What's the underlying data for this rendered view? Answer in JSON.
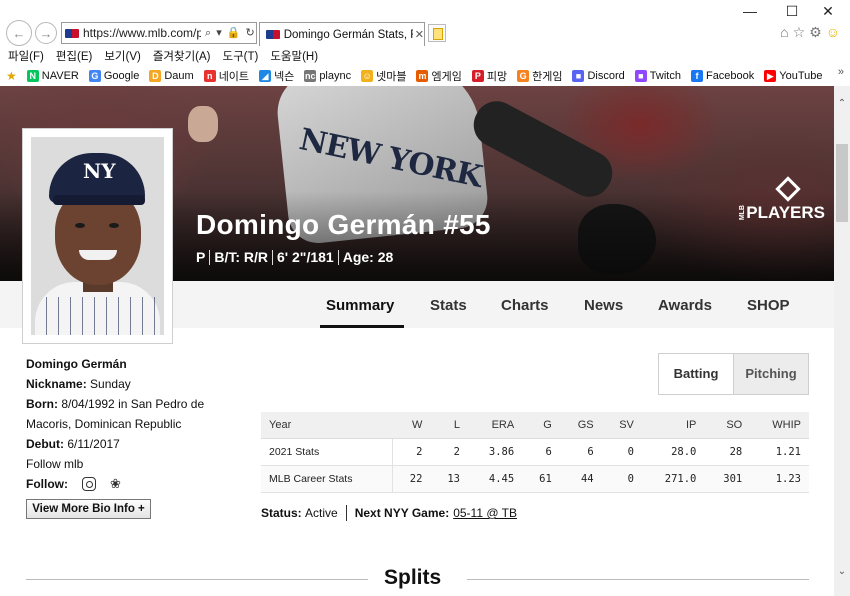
{
  "browser": {
    "url": "https://www.mlb.com/plá",
    "addr_icons": "⌕ ▾ 🔒 ↻",
    "tab_title": "Domingo Germán Stats, Fa...",
    "menu": [
      "파일(F)",
      "편집(E)",
      "보기(V)",
      "즐겨찾기(A)",
      "도구(T)",
      "도움말(H)"
    ],
    "favorites": [
      {
        "label": "NAVER",
        "icon": "naver-icon",
        "color": "#03c75a",
        "glyph": "N"
      },
      {
        "label": "Google",
        "icon": "google-icon",
        "color": "#4285f4",
        "glyph": "G"
      },
      {
        "label": "Daum",
        "icon": "daum-icon",
        "color": "#f5a623",
        "glyph": "D"
      },
      {
        "label": "네이트",
        "icon": "nate-icon",
        "color": "#e8322f",
        "glyph": "n"
      },
      {
        "label": "넥슨",
        "icon": "nexon-icon",
        "color": "#1e88e5",
        "glyph": "◢"
      },
      {
        "label": "plaync",
        "icon": "plaync-icon",
        "color": "#777777",
        "glyph": "nc"
      },
      {
        "label": "넷마블",
        "icon": "netmarble-icon",
        "color": "#f3b21c",
        "glyph": "☺"
      },
      {
        "label": "엠게임",
        "icon": "mgame-icon",
        "color": "#e65c00",
        "glyph": "m"
      },
      {
        "label": "피망",
        "icon": "pmang-icon",
        "color": "#d61e28",
        "glyph": "P"
      },
      {
        "label": "한게임",
        "icon": "hangame-icon",
        "color": "#f58220",
        "glyph": "G"
      },
      {
        "label": "Discord",
        "icon": "discord-icon",
        "color": "#5865f2",
        "glyph": "■"
      },
      {
        "label": "Twitch",
        "icon": "twitch-icon",
        "color": "#9146ff",
        "glyph": "■"
      },
      {
        "label": "Facebook",
        "icon": "facebook-icon",
        "color": "#1877f2",
        "glyph": "f"
      },
      {
        "label": "YouTube",
        "icon": "youtube-icon",
        "color": "#ff0000",
        "glyph": "▶"
      }
    ]
  },
  "hero": {
    "name": "Domingo Germán #55",
    "position": "P",
    "bats_throws": "B/T: R/R",
    "height_weight": "6' 2\"/181",
    "age": "Age: 28",
    "logo_text": "PLAYERS",
    "logo_small": "MLB",
    "jersey_text": "NEW YORK",
    "cap_logo": "NY"
  },
  "subnav": [
    "Summary",
    "Stats",
    "Charts",
    "News",
    "Awards",
    "SHOP"
  ],
  "bio": {
    "full_name": "Domingo Germán",
    "nickname_label": "Nickname:",
    "nickname": "Sunday",
    "born_label": "Born:",
    "born": "8/04/1992 in San Pedro de Macoris, Dominican Republic",
    "debut_label": "Debut:",
    "debut": "6/11/2017",
    "follow_mlb": "Follow mlb",
    "follow_label": "Follow:",
    "more_button": "View More Bio Info +"
  },
  "toggle": {
    "batting": "Batting",
    "pitching": "Pitching"
  },
  "stats_table": {
    "headers": [
      "Year",
      "W",
      "L",
      "ERA",
      "G",
      "GS",
      "SV",
      "IP",
      "SO",
      "WHIP"
    ],
    "rows": [
      [
        "2021 Stats",
        "2",
        "2",
        "3.86",
        "6",
        "6",
        "0",
        "28.0",
        "28",
        "1.21"
      ],
      [
        "MLB Career Stats",
        "22",
        "13",
        "4.45",
        "61",
        "44",
        "0",
        "271.0",
        "301",
        "1.23"
      ]
    ]
  },
  "status": {
    "status_label": "Status:",
    "status_value": "Active",
    "next_game_label": "Next NYY Game:",
    "next_game_value": "05-11 @ TB"
  },
  "splits_title": "Splits"
}
